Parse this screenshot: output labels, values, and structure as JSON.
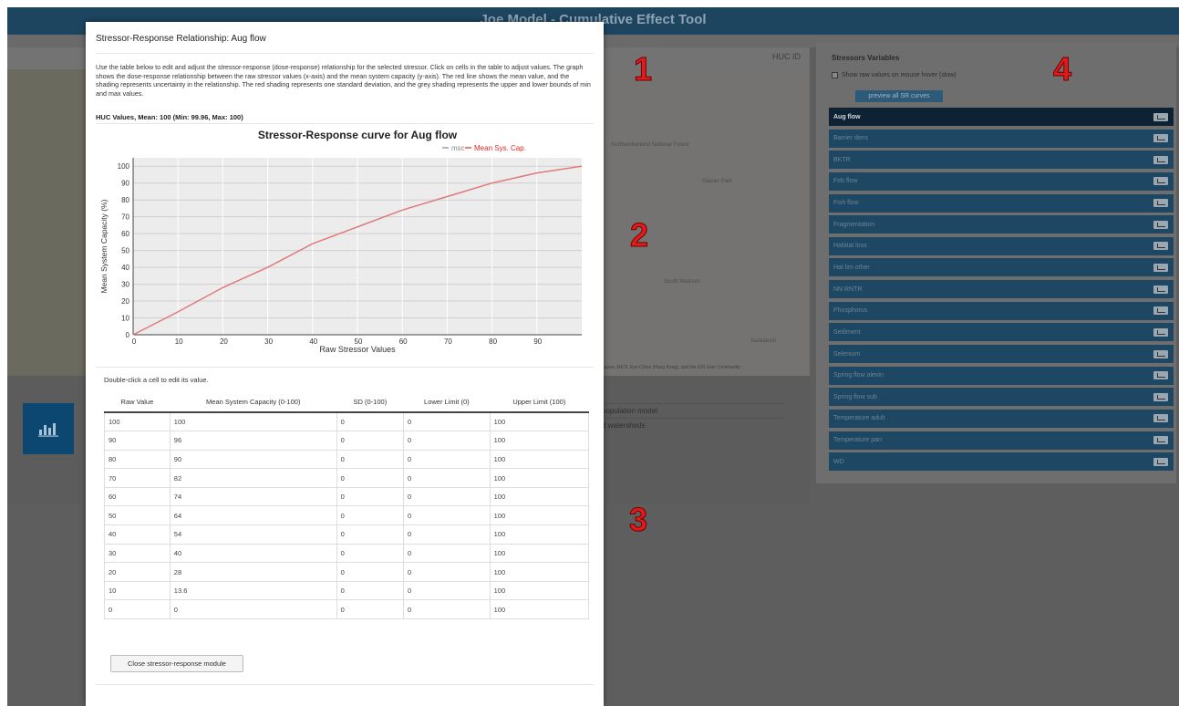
{
  "app": {
    "title": "Joe Model - Cumulative Effect Tool",
    "huc_id_label": "HUC ID",
    "attribution": "Japan, METI, Esri China (Hong Kong), and the GIS User Community",
    "bg_text_1": "population model",
    "bg_text_2": "d watersheds",
    "map_labels": [
      "Northumberland National Forest",
      "Glacier Park",
      "South Madison",
      "Saskatoon"
    ]
  },
  "annotations": [
    "1",
    "2",
    "3",
    "4"
  ],
  "modal": {
    "title": "Stressor-Response Relationship: Aug flow",
    "description": "Use the table below to edit and adjust the stressor-response (dose-response) relationship for the selected stressor. Click on cells in the table to adjust values. The graph shows the dose-response relationship between the raw stressor values (x-axis) and the mean system capacity (y-axis). The red line shows the mean value, and the shading represents uncertainty in the relationship. The red shading represents one standard deviation, and the grey shading represents the upper and lower bounds of min and max values.",
    "huc_values": "HUC Values, Mean: 100 (Min: 99.96, Max: 100)",
    "double_click_note": "Double-click a cell to edit its value.",
    "close_button": "Close stressor-response module",
    "table": {
      "headers": [
        "Raw Value",
        "Mean System Capacity (0-100)",
        "SD (0-100)",
        "Lower Limit (0)",
        "Upper Limit (100)"
      ],
      "rows": [
        [
          "100",
          "100",
          "0",
          "0",
          "100"
        ],
        [
          "90",
          "96",
          "0",
          "0",
          "100"
        ],
        [
          "80",
          "90",
          "0",
          "0",
          "100"
        ],
        [
          "70",
          "82",
          "0",
          "0",
          "100"
        ],
        [
          "60",
          "74",
          "0",
          "0",
          "100"
        ],
        [
          "50",
          "64",
          "0",
          "0",
          "100"
        ],
        [
          "40",
          "54",
          "0",
          "0",
          "100"
        ],
        [
          "30",
          "40",
          "0",
          "0",
          "100"
        ],
        [
          "20",
          "28",
          "0",
          "0",
          "100"
        ],
        [
          "10",
          "13.6",
          "0",
          "0",
          "100"
        ],
        [
          "0",
          "0",
          "0",
          "0",
          "100"
        ]
      ]
    }
  },
  "chart_data": {
    "type": "line",
    "title": "Stressor-Response curve for Aug flow",
    "xlabel": "Raw Stressor Values",
    "ylabel": "Mean System Capacity (%)",
    "xlim": [
      0,
      100
    ],
    "ylim": [
      0,
      105
    ],
    "x_ticks": [
      0,
      10,
      20,
      30,
      40,
      50,
      60,
      70,
      80,
      90
    ],
    "y_ticks": [
      0,
      10,
      20,
      30,
      40,
      50,
      60,
      70,
      80,
      90,
      100
    ],
    "grid": true,
    "legend_position": "top-right",
    "legend": [
      "msc",
      "Mean Sys. Cap."
    ],
    "legend_colors": [
      "#888888",
      "#e8261e"
    ],
    "series": [
      {
        "name": "Mean Sys. Cap.",
        "color": "#e07a7a",
        "x": [
          0,
          10,
          20,
          30,
          40,
          50,
          60,
          70,
          80,
          90,
          100
        ],
        "y": [
          0,
          13.6,
          28,
          40,
          54,
          64,
          74,
          82,
          90,
          96,
          100
        ]
      }
    ]
  },
  "stressor_panel": {
    "title": "Stressors Variables",
    "show_raw_label": "Show raw values on mouse hover (slow)",
    "preview_button": "preview all SR curves",
    "items": [
      "Aug flow",
      "Barrier dens",
      "BKTR",
      "Feb flow",
      "Fish flow",
      "Fragmentation",
      "Habitat loss",
      "Hat lim other",
      "NN RNTR",
      "Phosphorus",
      "Sediment",
      "Selenium",
      "Spring flow alevin",
      "Spring flow sub",
      "Temperature adult",
      "Temperature parr",
      "WD"
    ],
    "active_index": 0
  }
}
